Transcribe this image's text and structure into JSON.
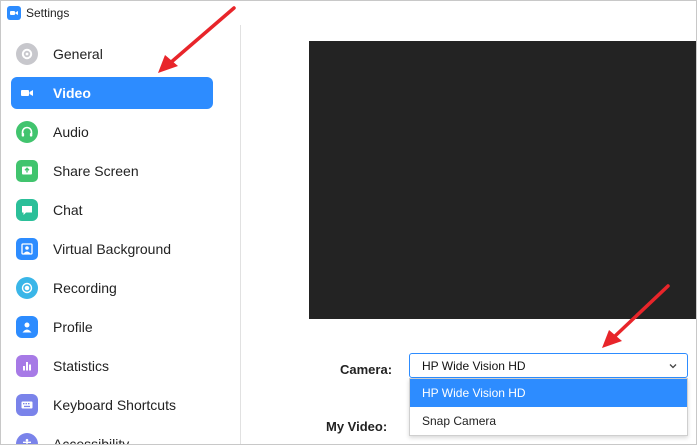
{
  "window": {
    "title": "Settings",
    "app_icon": "zoom-camera-icon"
  },
  "accent_color": "#2d8cff",
  "sidebar": {
    "active_index": 1,
    "items": [
      {
        "label": "General",
        "icon": "gear-icon",
        "color": "#c7c7cc"
      },
      {
        "label": "Video",
        "icon": "video-camera-icon",
        "color": "#ffffff"
      },
      {
        "label": "Audio",
        "icon": "headphones-icon",
        "color": "#41c46e"
      },
      {
        "label": "Share Screen",
        "icon": "share-screen-icon",
        "color": "#41c46e"
      },
      {
        "label": "Chat",
        "icon": "chat-bubble-icon",
        "color": "#2bbf99"
      },
      {
        "label": "Virtual Background",
        "icon": "virtual-background-icon",
        "color": "#2d8cff"
      },
      {
        "label": "Recording",
        "icon": "recording-icon",
        "color": "#3ab6e8"
      },
      {
        "label": "Profile",
        "icon": "profile-icon",
        "color": "#2d8cff"
      },
      {
        "label": "Statistics",
        "icon": "statistics-icon",
        "color": "#a77ae6"
      },
      {
        "label": "Keyboard Shortcuts",
        "icon": "keyboard-icon",
        "color": "#7a83ea"
      },
      {
        "label": "Accessibility",
        "icon": "accessibility-icon",
        "color": "#7a83ea"
      }
    ]
  },
  "video": {
    "camera_label": "Camera:",
    "camera_selected": "HP Wide Vision HD",
    "camera_options": [
      "HP Wide Vision HD",
      "Snap Camera"
    ],
    "my_video_label": "My Video:"
  },
  "annotation_color": "#e8252a"
}
